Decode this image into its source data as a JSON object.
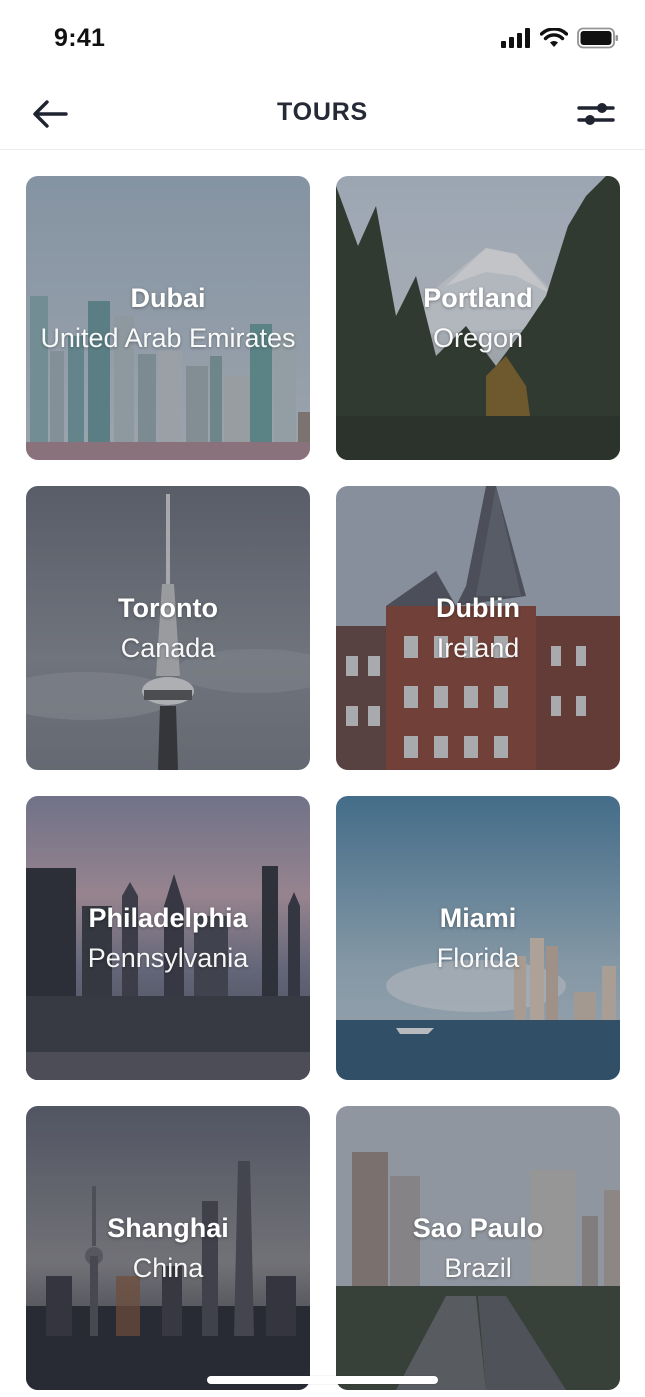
{
  "status_bar": {
    "time": "9:41"
  },
  "nav": {
    "title": "TOURS",
    "back_icon": "arrow-left-icon",
    "filter_icon": "sliders-icon"
  },
  "tours": [
    {
      "city": "Dubai",
      "region": "United Arab Emirates"
    },
    {
      "city": "Portland",
      "region": "Oregon"
    },
    {
      "city": "Toronto",
      "region": "Canada"
    },
    {
      "city": "Dublin",
      "region": "Ireland"
    },
    {
      "city": "Philadelphia",
      "region": "Pennsylvania"
    },
    {
      "city": "Miami",
      "region": "Florida"
    },
    {
      "city": "Shanghai",
      "region": "China"
    },
    {
      "city": "Sao Paulo",
      "region": "Brazil"
    }
  ],
  "colors": {
    "title_text": "#252a36",
    "card_overlay": "rgba(40,44,58,0.28)",
    "caption_text": "#ffffff"
  }
}
